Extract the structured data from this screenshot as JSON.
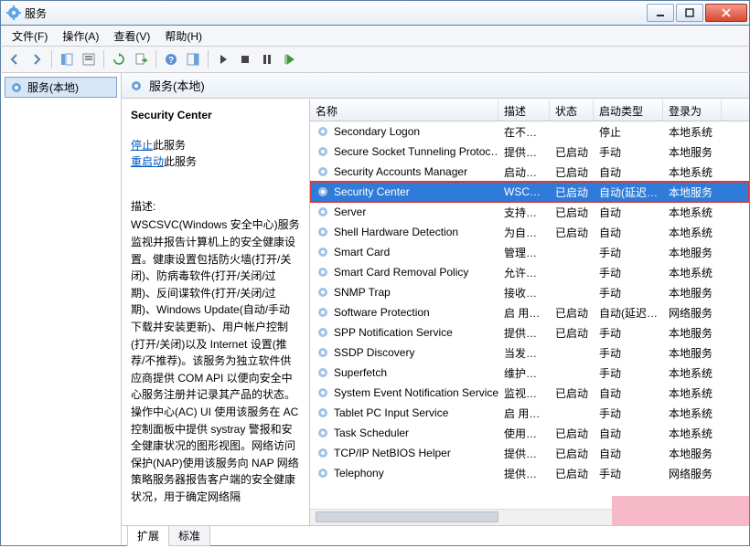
{
  "window": {
    "title": "服务"
  },
  "menu": {
    "file": "文件(F)",
    "action": "操作(A)",
    "view": "查看(V)",
    "help": "帮助(H)"
  },
  "tree": {
    "root": "服务(本地)"
  },
  "panel_title": "服务(本地)",
  "detail": {
    "name": "Security Center",
    "stop_link": "停止",
    "stop_suffix": "此服务",
    "restart_link": "重启动",
    "restart_suffix": "此服务",
    "desc_label": "描述:",
    "desc_text": "WSCSVC(Windows 安全中心)服务监视并报告计算机上的安全健康设置。健康设置包括防火墙(打开/关闭)、防病毒软件(打开/关闭/过期)、反间谍软件(打开/关闭/过期)、Windows Update(自动/手动下载并安装更新)、用户帐户控制(打开/关闭)以及 Internet 设置(推荐/不推荐)。该服务为独立软件供应商提供 COM API 以便向安全中心服务注册并记录其产品的状态。操作中心(AC) UI 使用该服务在 AC 控制面板中提供 systray 警报和安全健康状况的图形视图。网络访问保护(NAP)使用该服务向 NAP 网络策略服务器报告客户端的安全健康状况，用于确定网络隔"
  },
  "columns": {
    "name": "名称",
    "desc": "描述",
    "state": "状态",
    "start": "启动类型",
    "logon": "登录为"
  },
  "services": [
    {
      "name": "Secondary Logon",
      "desc": "在不…",
      "state": "",
      "start": "停止",
      "logon": "本地系统"
    },
    {
      "name": "Secure Socket Tunneling Protoc…",
      "desc": "提供…",
      "state": "已启动",
      "start": "手动",
      "logon": "本地服务"
    },
    {
      "name": "Security Accounts Manager",
      "desc": "启动…",
      "state": "已启动",
      "start": "自动",
      "logon": "本地系统"
    },
    {
      "name": "Security Center",
      "desc": "WSC…",
      "state": "已启动",
      "start": "自动(延迟…",
      "logon": "本地服务",
      "selected": true
    },
    {
      "name": "Server",
      "desc": "支持…",
      "state": "已启动",
      "start": "自动",
      "logon": "本地系统"
    },
    {
      "name": "Shell Hardware Detection",
      "desc": "为自…",
      "state": "已启动",
      "start": "自动",
      "logon": "本地系统"
    },
    {
      "name": "Smart Card",
      "desc": "管理…",
      "state": "",
      "start": "手动",
      "logon": "本地服务"
    },
    {
      "name": "Smart Card Removal Policy",
      "desc": "允许…",
      "state": "",
      "start": "手动",
      "logon": "本地系统"
    },
    {
      "name": "SNMP Trap",
      "desc": "接收…",
      "state": "",
      "start": "手动",
      "logon": "本地服务"
    },
    {
      "name": "Software Protection",
      "desc": "启 用…",
      "state": "已启动",
      "start": "自动(延迟…",
      "logon": "网络服务"
    },
    {
      "name": "SPP Notification Service",
      "desc": "提供…",
      "state": "已启动",
      "start": "手动",
      "logon": "本地服务"
    },
    {
      "name": "SSDP Discovery",
      "desc": "当发…",
      "state": "",
      "start": "手动",
      "logon": "本地服务"
    },
    {
      "name": "Superfetch",
      "desc": "维护…",
      "state": "",
      "start": "手动",
      "logon": "本地系统"
    },
    {
      "name": "System Event Notification Service",
      "desc": "监视…",
      "state": "已启动",
      "start": "自动",
      "logon": "本地系统"
    },
    {
      "name": "Tablet PC Input Service",
      "desc": "启 用…",
      "state": "",
      "start": "手动",
      "logon": "本地系统"
    },
    {
      "name": "Task Scheduler",
      "desc": "使用…",
      "state": "已启动",
      "start": "自动",
      "logon": "本地系统"
    },
    {
      "name": "TCP/IP NetBIOS Helper",
      "desc": "提供…",
      "state": "已启动",
      "start": "自动",
      "logon": "本地服务"
    },
    {
      "name": "Telephony",
      "desc": "提供…",
      "state": "已启动",
      "start": "手动",
      "logon": "网络服务"
    }
  ],
  "tabs": {
    "extended": "扩展",
    "standard": "标准"
  }
}
